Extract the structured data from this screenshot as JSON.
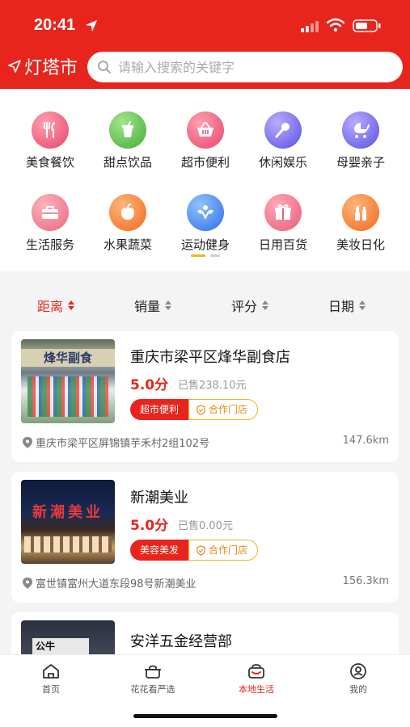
{
  "status_bar": {
    "time": "20:41"
  },
  "header": {
    "brand": "灯塔市",
    "search_placeholder": "请输入搜索的关键字"
  },
  "categories": [
    {
      "label": "美食餐饮",
      "icon": "fork-knife-icon",
      "color": "#ef5d7a"
    },
    {
      "label": "甜点饮品",
      "icon": "drink-cup-icon",
      "color": "#5cc24a"
    },
    {
      "label": "超市便利",
      "icon": "basket-icon",
      "color": "#ef5d7a"
    },
    {
      "label": "休闲娱乐",
      "icon": "microphone-icon",
      "color": "#7a6ef0"
    },
    {
      "label": "母婴亲子",
      "icon": "stroller-icon",
      "color": "#7a6ef0"
    },
    {
      "label": "生活服务",
      "icon": "toolbox-icon",
      "color": "#ef5d7a"
    },
    {
      "label": "水果蔬菜",
      "icon": "apple-icon",
      "color": "#f2722b"
    },
    {
      "label": "运动健身",
      "icon": "fitness-icon",
      "color": "#3a7ef2"
    },
    {
      "label": "日用百货",
      "icon": "gift-icon",
      "color": "#ef5d7a"
    },
    {
      "label": "美妆日化",
      "icon": "lipstick-icon",
      "color": "#f2722b"
    }
  ],
  "sort": [
    {
      "label": "距离",
      "active": true
    },
    {
      "label": "销量",
      "active": false
    },
    {
      "label": "评分",
      "active": false
    },
    {
      "label": "日期",
      "active": false
    }
  ],
  "stores": [
    {
      "name": "重庆市梁平区烽华副食店",
      "rating": "5.0分",
      "sold": "已售238.10元",
      "category_tag": "超市便利",
      "partner_tag": "合作门店",
      "address": "重庆市梁平区屏锦镇芋禾村2组102号",
      "distance": "147.6km",
      "image_sign": "烽华副食"
    },
    {
      "name": "新潮美业",
      "rating": "5.0分",
      "sold": "已售0.00元",
      "category_tag": "美容美发",
      "partner_tag": "合作门店",
      "address": "富世镇富州大道东段98号新潮美业",
      "distance": "156.3km",
      "image_sign": "新潮美业"
    },
    {
      "name": "安洋五金经营部",
      "image_sign": "公牛"
    }
  ],
  "tabbar": [
    {
      "label": "首页",
      "icon": "home-icon",
      "active": false
    },
    {
      "label": "花花看严选",
      "icon": "pot-icon",
      "active": false
    },
    {
      "label": "本地生活",
      "icon": "local-life-icon",
      "active": true
    },
    {
      "label": "我的",
      "icon": "profile-icon",
      "active": false
    }
  ],
  "colors": {
    "brand_red": "#e8251d",
    "accent_gold": "#f3b325"
  }
}
